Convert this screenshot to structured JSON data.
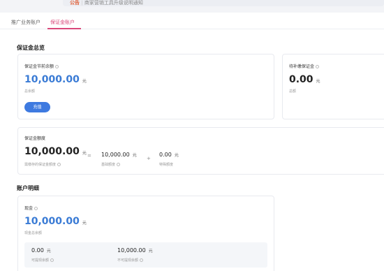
{
  "notice": {
    "tag": "公告",
    "text": "商家营销工具升级说明通知"
  },
  "tabs": [
    {
      "label": "推广业务账户"
    },
    {
      "label": "保证金账户"
    }
  ],
  "overview": {
    "title": "保证金总览",
    "available": {
      "label": "保证金节前余额",
      "value": "10,000.00",
      "unit": "元",
      "sub": "总余额",
      "button": "充值"
    },
    "pending": {
      "label": "待补缴保证金",
      "value": "0.00",
      "unit": "元",
      "sub": "总额"
    },
    "limit": {
      "label": "保证金额度",
      "total": {
        "value": "10,000.00",
        "unit": "元",
        "sub": "需缴存的保证金额度"
      },
      "eq": "=",
      "part1": {
        "value": "10,000.00",
        "unit": "元",
        "sub": "基础额度"
      },
      "plus": "+",
      "part2": {
        "value": "0.00",
        "unit": "元",
        "sub": "特殊额度"
      }
    }
  },
  "details": {
    "title": "账户明细",
    "cash": {
      "label": "现金",
      "value": "10,000.00",
      "unit": "元",
      "sub": "现金总余额",
      "withdrawable": {
        "value": "0.00",
        "unit": "元",
        "sub": "可提现余额"
      },
      "locked": {
        "value": "10,000.00",
        "unit": "元",
        "sub": "不可提现余额"
      }
    }
  }
}
